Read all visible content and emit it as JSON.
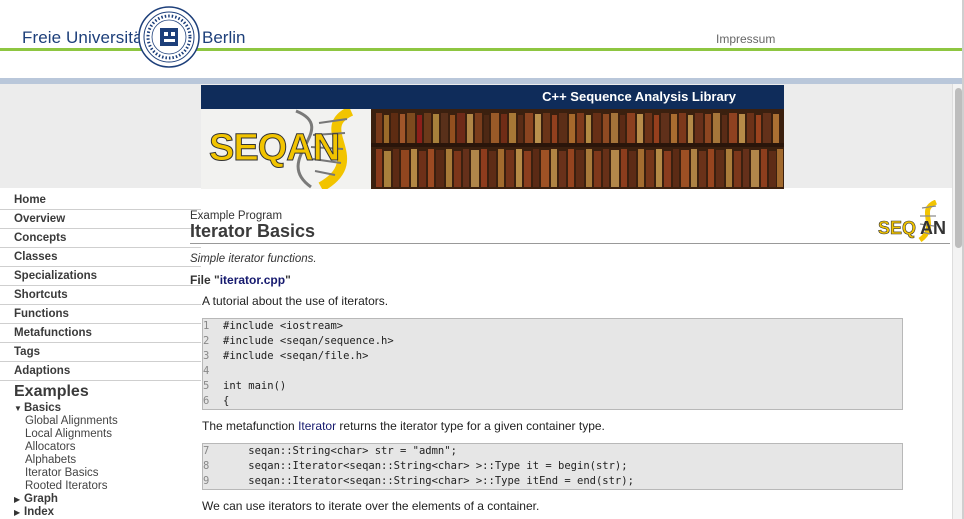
{
  "header": {
    "university_name": "Freie Universität",
    "university_city": "Berlin",
    "impressum_label": "Impressum"
  },
  "banner": {
    "title": "C++ Sequence Analysis Library",
    "logo_text": "SEQAN"
  },
  "sidebar": {
    "nav_items": [
      {
        "label": "Home"
      },
      {
        "label": "Overview"
      },
      {
        "label": "Concepts"
      },
      {
        "label": "Classes"
      },
      {
        "label": "Specializations"
      },
      {
        "label": "Shortcuts"
      },
      {
        "label": "Functions"
      },
      {
        "label": "Metafunctions"
      },
      {
        "label": "Tags"
      },
      {
        "label": "Adaptions"
      }
    ],
    "examples_heading": "Examples",
    "tree": {
      "basics": {
        "label": "Basics",
        "children": [
          "Global Alignments",
          "Local Alignments",
          "Allocators",
          "Alphabets",
          "Iterator Basics",
          "Rooted Iterators"
        ]
      },
      "graph": "Graph",
      "index": "Index"
    }
  },
  "main": {
    "kicker": "Example Program",
    "title": "Iterator Basics",
    "subtitle": "Simple iterator functions.",
    "file_prefix": "File \"",
    "file_name": "iterator.cpp",
    "file_suffix": "\"",
    "intro": "A tutorial about the use of iterators.",
    "code_block_1": [
      {
        "n": "1",
        "code": "#include <iostream>"
      },
      {
        "n": "2",
        "code": "#include <seqan/sequence.h>"
      },
      {
        "n": "3",
        "code": "#include <seqan/file.h>"
      },
      {
        "n": "4",
        "code": ""
      },
      {
        "n": "5",
        "code": "int main()"
      },
      {
        "n": "6",
        "code": "{"
      }
    ],
    "para2_before": "The metafunction ",
    "para2_link": "Iterator",
    "para2_after": " returns the iterator type for a given container type.",
    "code_block_2": [
      {
        "n": "7",
        "code": "    seqan::String<char> str = \"admn\";"
      },
      {
        "n": "8",
        "code": "    seqan::Iterator<seqan::String<char> >::Type it = begin(str);"
      },
      {
        "n": "9",
        "code": "    seqan::Iterator<seqan::String<char> >::Type itEnd = end(str);"
      }
    ],
    "para3": "We can use iterators to iterate over the elements of a container."
  },
  "colors": {
    "green_rule": "#8ec641",
    "banner_navy": "#0f2c5a",
    "fu_blue": "#1d3f7a",
    "link": "#15196e"
  }
}
